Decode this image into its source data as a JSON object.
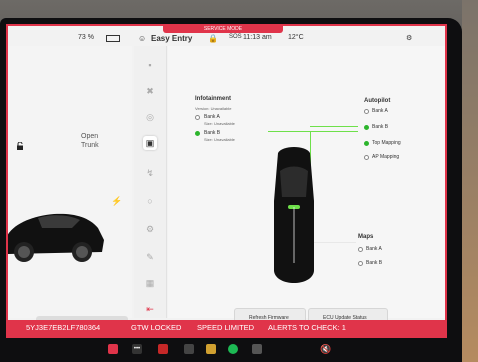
{
  "banner": {
    "service_mode": "SERVICE MODE"
  },
  "status_bar": {
    "battery": "73 %",
    "profile": "Easy Entry",
    "time": "11:13 am",
    "temperature": "12°C",
    "sos": "SOS"
  },
  "left_panel": {
    "trunk_label": "Open\nTrunk"
  },
  "nav": {
    "items": [
      {
        "icon": "car-icon"
      },
      {
        "icon": "wrench-icon"
      },
      {
        "icon": "steering-icon"
      },
      {
        "icon": "chip-icon"
      },
      {
        "icon": "bolt-icon"
      },
      {
        "icon": "wheel-icon"
      },
      {
        "icon": "gear-icon"
      },
      {
        "icon": "pencil-icon"
      },
      {
        "icon": "grid-icon"
      },
      {
        "icon": "exit-icon"
      }
    ]
  },
  "infotainment": {
    "title": "Infotainment",
    "subtitle": "Version: Unavailable",
    "bank_a": {
      "label": "Bank A",
      "detail": "Size: Unavailable"
    },
    "bank_b": {
      "label": "Bank B",
      "detail": "Size: Unavailable"
    }
  },
  "autopilot": {
    "title": "Autopilot",
    "items": [
      {
        "label": "Bank A",
        "on": false
      },
      {
        "label": "Bank B",
        "on": true
      },
      {
        "label": "Top Mapping",
        "on": true
      },
      {
        "label": "AP Mapping",
        "on": false
      }
    ]
  },
  "maps": {
    "title": "Maps",
    "items": [
      {
        "label": "Bank A"
      },
      {
        "label": "Bank B"
      }
    ]
  },
  "buttons": {
    "left": "Refresh Firmware",
    "right": "ECU Update Status"
  },
  "alert_bar": {
    "vin": "5YJ3E7EB2LF780364",
    "gtw": "GTW LOCKED",
    "speed": "SPEED LIMITED",
    "alerts": "ALERTS TO CHECK: 1"
  },
  "colors": {
    "accent": "#e0344a",
    "ok_green": "#2db52d",
    "wire_green": "#6ee04a"
  }
}
